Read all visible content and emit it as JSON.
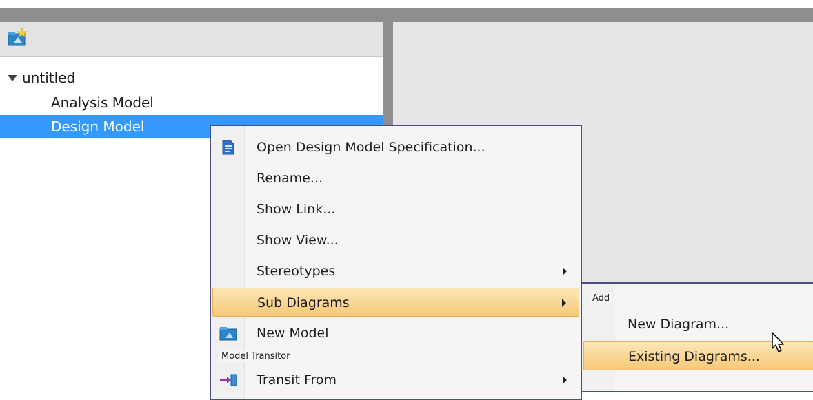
{
  "tree": {
    "root_label": "untitled",
    "children": [
      "Analysis Model",
      "Design Model"
    ],
    "selected_index": 1
  },
  "context_menu": {
    "items": [
      {
        "label": "Open Design Model Specification...",
        "icon": "spec-document-icon"
      },
      {
        "label": "Rename...",
        "icon": ""
      },
      {
        "label": "Show Link...",
        "icon": ""
      },
      {
        "label": "Show View...",
        "icon": ""
      },
      {
        "label": "Stereotypes",
        "icon": "",
        "submenu": true
      },
      {
        "label": "Sub Diagrams",
        "icon": "",
        "submenu": true,
        "highlighted": true
      },
      {
        "label": "New Model",
        "icon": "model-icon"
      }
    ],
    "separator_label": "Model Transitor",
    "after_separator": [
      {
        "label": "Transit From",
        "icon": "transit-icon",
        "submenu": true
      }
    ]
  },
  "sub_menu": {
    "separator_label": "Add",
    "items": [
      {
        "label": "New Diagram...",
        "highlighted": false
      },
      {
        "label": "Existing Diagrams...",
        "highlighted": true
      }
    ]
  },
  "colors": {
    "selection": "#3399ff",
    "menu_border": "#4a4e8a",
    "highlight": "#f7c877"
  }
}
